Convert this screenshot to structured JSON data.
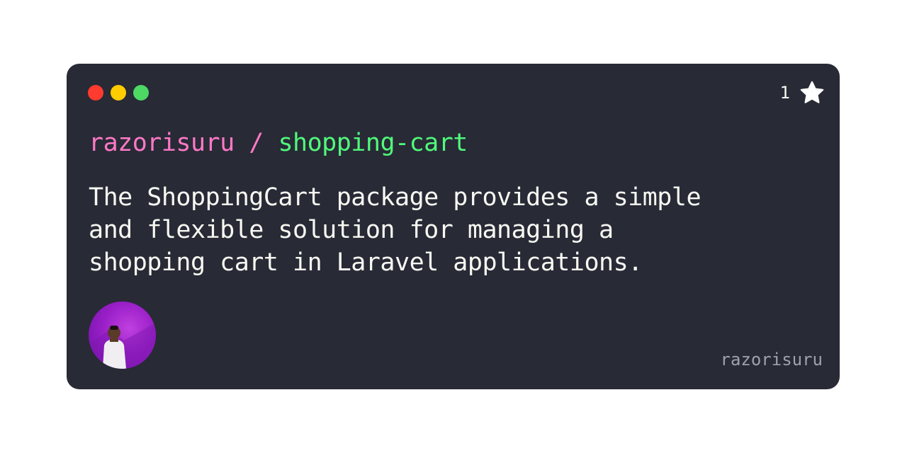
{
  "card": {
    "window_dots": [
      "red-dot",
      "yellow-dot",
      "green-dot"
    ],
    "stars": {
      "count": "1",
      "icon": "star-icon"
    },
    "repo": {
      "owner": "razorisuru",
      "separator": " / ",
      "name": "shopping-cart"
    },
    "description": "The ShoppingCart package provides a simple and flexible solution for managing a shopping cart in Laravel applications.",
    "avatar": "avatar-photo",
    "username": "razorisuru"
  },
  "colors": {
    "background": "#282a36",
    "owner": "#ff79c6",
    "repo_name": "#50fa7b",
    "text": "#f8f8f2",
    "muted": "#a0a0a8",
    "dot_red": "#ff3b30",
    "dot_yellow": "#ffcc00",
    "dot_green": "#4cd964"
  }
}
